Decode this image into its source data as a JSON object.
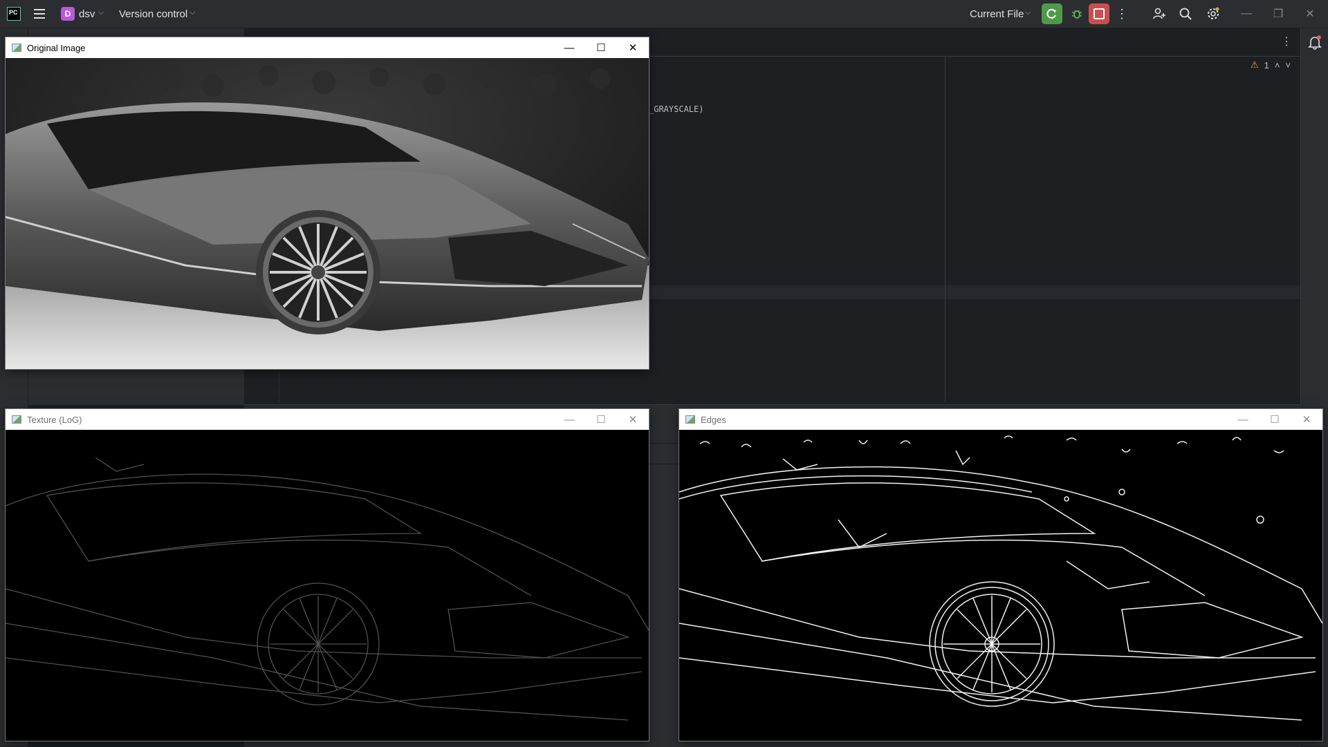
{
  "ide": {
    "logo_text": "PC",
    "project_initial": "D",
    "project_name": "dsv",
    "vcs_label": "Version control",
    "run_config": "Current File",
    "code_fragment": "_GRAYSCALE)",
    "inspection_count": "1"
  },
  "windows": {
    "original": {
      "title": "Original Image"
    },
    "texture": {
      "title": "Texture (LoG)"
    },
    "edges": {
      "title": "Edges"
    }
  },
  "icons": [
    "menu-icon",
    "chevron-down-icon",
    "run-icon",
    "debug-icon",
    "stop-icon",
    "more-vertical-icon",
    "add-user-icon",
    "search-icon",
    "gear-icon",
    "minimize-icon",
    "maximize-icon",
    "close-icon",
    "bell-icon",
    "warning-icon",
    "chevron-up-icon"
  ],
  "colors": {
    "run": "#4e9a4a",
    "stop": "#c94f4f",
    "project_badge": "#b65bd9",
    "warning": "#e3a13b"
  }
}
